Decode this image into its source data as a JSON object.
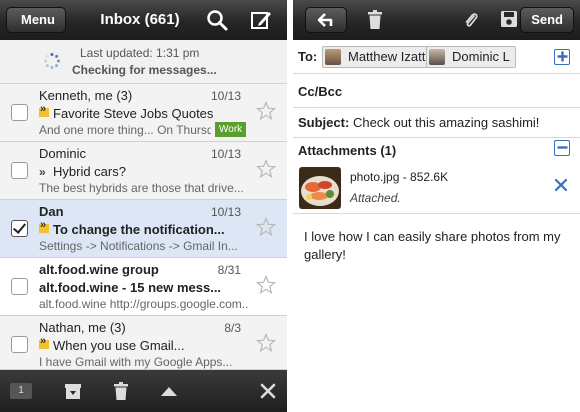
{
  "inbox": {
    "menu_label": "Menu",
    "title": "Inbox (661)",
    "status": {
      "updated": "Last updated: 1:31 pm",
      "checking": "Checking for messages..."
    },
    "messages": [
      {
        "sender": "Kenneth, me (3)",
        "date": "10/13",
        "subject": "Favorite Steve Jobs Quotes",
        "snippet": "And one more thing... On Thursday...",
        "label": "Work"
      },
      {
        "sender": "Dominic",
        "date": "10/13",
        "subject": "Hybrid cars?",
        "snippet": "The best hybrids are those that drive..."
      },
      {
        "sender": "Dan",
        "date": "10/13",
        "subject": "To change the notification...",
        "snippet": "Settings -> Notifications -> Gmail In..."
      },
      {
        "sender": "alt.food.wine group",
        "date": "8/31",
        "subject": "alt.food.wine - 15 new mess...",
        "snippet": "alt.food.wine http://groups.google.com..."
      },
      {
        "sender": "Nathan, me (3)",
        "date": "8/3",
        "subject": "When you use Gmail...",
        "snippet": "I have Gmail with my Google Apps..."
      }
    ],
    "bottom": {
      "count": "1"
    }
  },
  "compose": {
    "send_label": "Send",
    "to_label": "To:",
    "recipients": [
      "Matthew Izatt",
      "Dominic L"
    ],
    "ccbcc_label": "Cc/Bcc",
    "subject_label": "Subject:",
    "subject_value": "Check out this amazing sashimi!",
    "attachments_label": "Attachments (1)",
    "attachment_name": "photo.jpg - 852.6K",
    "attachment_status": "Attached.",
    "body": "I love how I can easily share photos from my gallery!"
  },
  "colors": {
    "toolbar_dark": "#262626",
    "selected_row": "#dce6f5",
    "label_work": "#5a9e2c",
    "accent_blue": "#3a6fbc"
  },
  "icons": [
    "search-icon",
    "compose-icon",
    "spinner-icon",
    "star-icon",
    "archive-icon",
    "trash-icon",
    "up-arrow-icon",
    "close-icon",
    "back-arrow-icon",
    "paperclip-icon",
    "save-icon",
    "plus-icon",
    "minus-icon"
  ]
}
